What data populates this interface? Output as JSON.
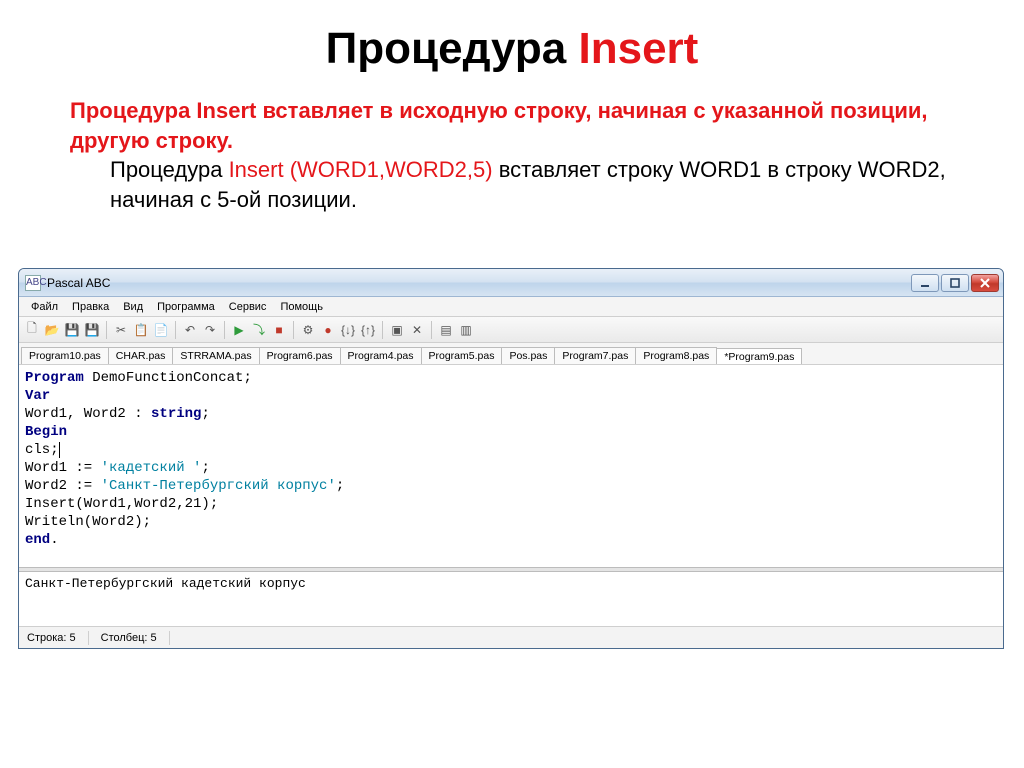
{
  "slide": {
    "title_black": "Процедура ",
    "title_red": "Insert",
    "p1a": "Процедура ",
    "p1b": "Insert",
    "p1c": " вставляет в исходную строку, начиная с указанной позиции, другую строку.",
    "p2a": "Процедура ",
    "p2b": "Insert (WORD1,WORD2,5)",
    "p2c": " вставляет строку WORD1  в строку WORD2, начиная с 5-ой позиции."
  },
  "window": {
    "title": "Pascal ABC",
    "icon_label": "ABC"
  },
  "menu": [
    "Файл",
    "Правка",
    "Вид",
    "Программа",
    "Сервис",
    "Помощь"
  ],
  "tabs": [
    {
      "label": "Program10.pas"
    },
    {
      "label": "CHAR.pas"
    },
    {
      "label": "STRRAMA.pas"
    },
    {
      "label": "Program6.pas"
    },
    {
      "label": "Program4.pas"
    },
    {
      "label": "Program5.pas"
    },
    {
      "label": "Pos.pas"
    },
    {
      "label": "Program7.pas"
    },
    {
      "label": "Program8.pas"
    },
    {
      "label": "*Program9.pas"
    }
  ],
  "active_tab_index": 9,
  "code": {
    "l1_kw": "Program",
    "l1_rest": " DemoFunctionConcat;",
    "l2": "Var",
    "l3a": "Word1, Word2 : ",
    "l3b": "string",
    "l3c": ";",
    "l4": "Begin",
    "l5": "cls;",
    "l6a": "Word1 := ",
    "l6b": "'кадетский '",
    "l6c": ";",
    "l7a": "Word2 := ",
    "l7b": "'Санкт-Петербургский корпус'",
    "l7c": ";",
    "l8": "Insert(Word1,Word2,21);",
    "l9": "Writeln(Word2);",
    "l10": "end",
    "l10b": "."
  },
  "output": "Санкт-Петербургский кадетский корпус",
  "status": {
    "line_lbl": "Строка:  5",
    "col_lbl": "Столбец:  5"
  }
}
